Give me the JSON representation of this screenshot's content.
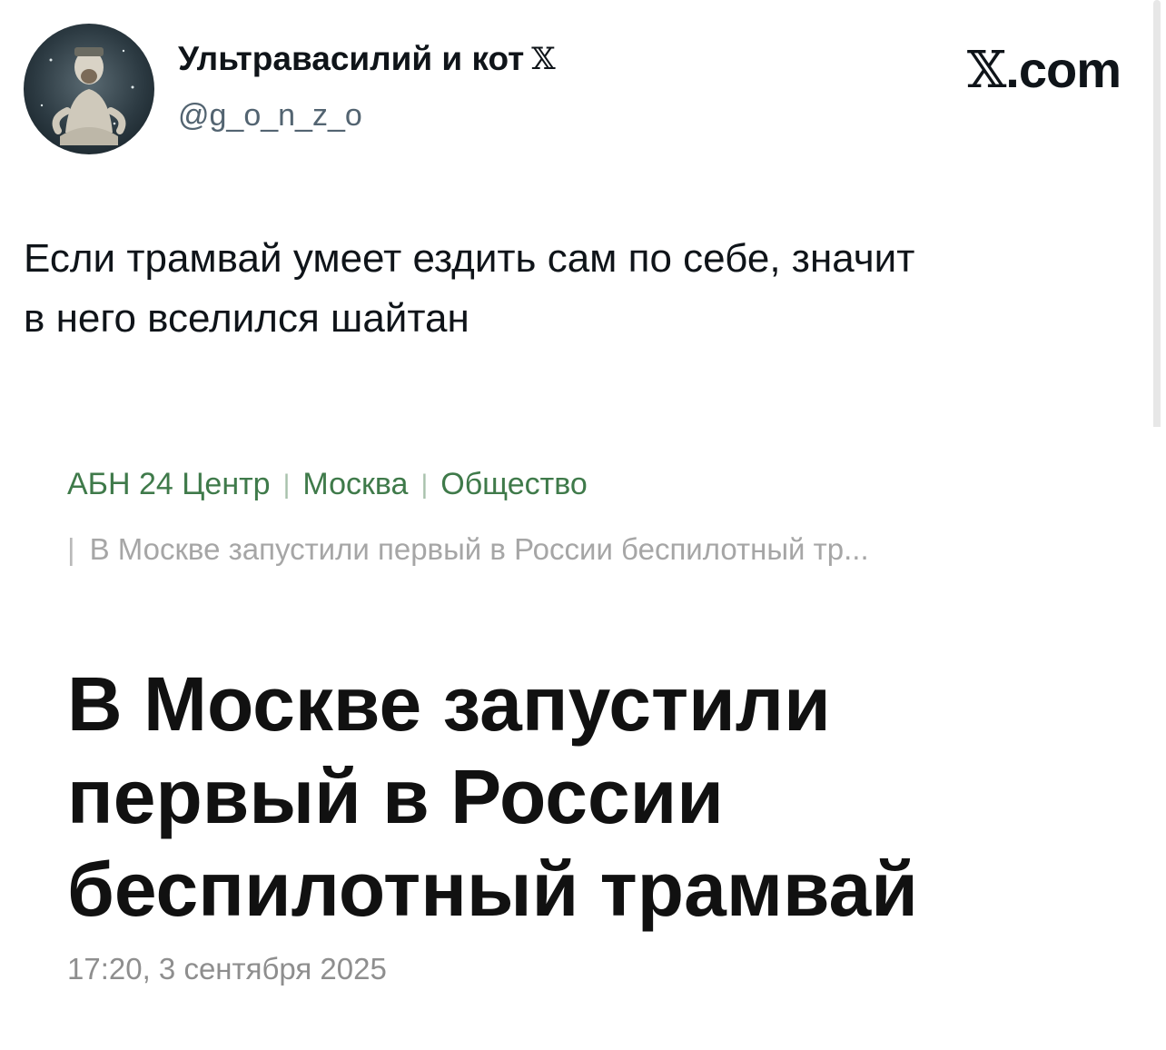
{
  "author": {
    "display_name": "Ультравасилий и кот",
    "name_badge_icon": "x-logo-icon",
    "handle": "@g_o_n_z_o",
    "avatar_icon": "user-avatar"
  },
  "brand": {
    "x_glyph": "𝕏",
    "suffix": ".com"
  },
  "tweet": {
    "text_line1": "Если трамвай умеет ездить сам по себе, значит",
    "text_line2": "в него вселился шайтан"
  },
  "article": {
    "breadcrumb": [
      "АБН 24 Центр",
      "Москва",
      "Общество"
    ],
    "sub_breadcrumb": "В Москве запустили первый в России беспилотный тр...",
    "headline_line1": "В Москве запустили",
    "headline_line2": "первый в России",
    "headline_line3": "беспилотный трамвай",
    "timestamp": "17:20, 3 сентября 2025",
    "colors": {
      "breadcrumb": "#3f7a4a",
      "sub_breadcrumb": "#a6a6a6",
      "timestamp": "#8e8e8e"
    }
  },
  "colors": {
    "text": "#0f1419",
    "handle": "#536471"
  }
}
